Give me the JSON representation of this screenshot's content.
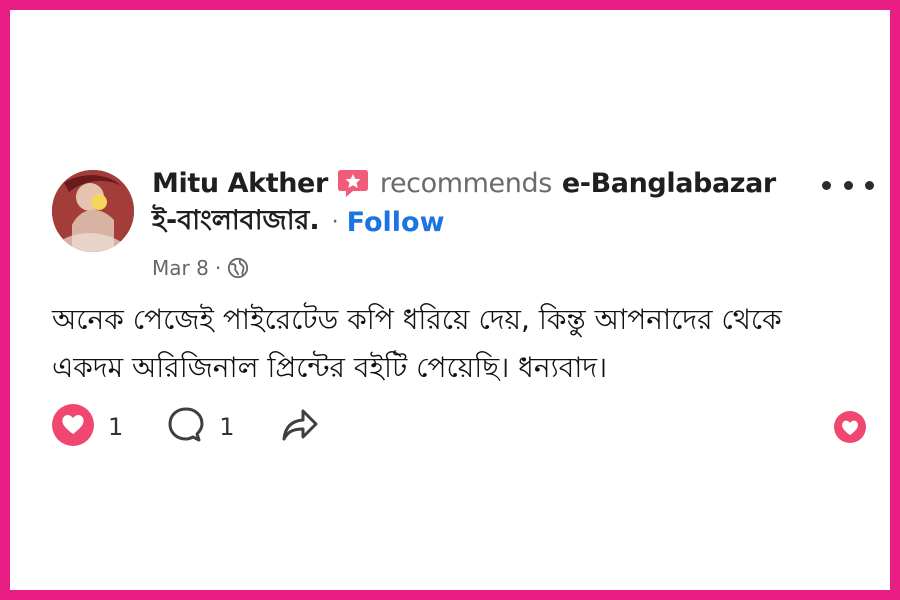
{
  "post": {
    "author": "Mitu Akther",
    "action": "recommends",
    "page_name": "e-Banglabazar",
    "page_name_local": "ই-বাংলাবাজার.",
    "separator": "·",
    "follow_label": "Follow",
    "date": "Mar 8",
    "meta_separator": "·",
    "text": "অনেক পেজেই পাইরেটেড কপি ধরিয়ে দেয়, কিন্তু আপনাদের থেকে একদম অরিজিনাল প্রিন্টের বইটি পেয়েছি। ধন্যবাদ।",
    "reaction_count": "1",
    "comment_count": "1"
  },
  "colors": {
    "frame": "#e91e84",
    "love": "#ef476f",
    "follow": "#1b74e4"
  },
  "icons": {
    "badge": "recommendation-badge-icon",
    "globe": "globe-icon",
    "more": "more-options-icon",
    "love": "love-reaction-icon",
    "comment": "comment-icon",
    "share": "share-icon"
  }
}
